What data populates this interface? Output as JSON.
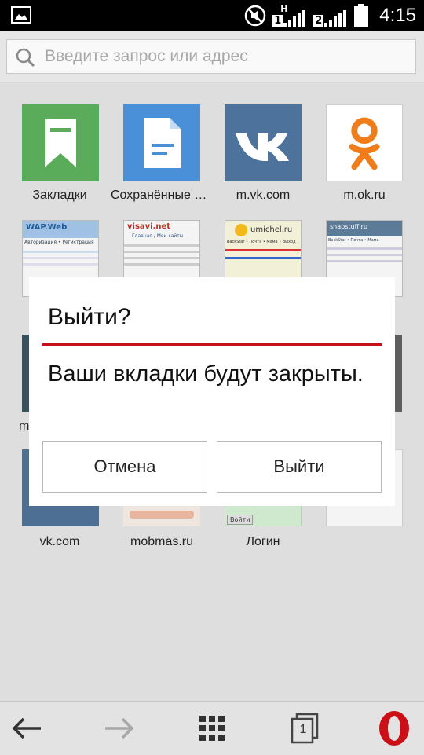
{
  "status_bar": {
    "time": "4:15",
    "icons": [
      "image-notification-icon",
      "mute-icon",
      "signal-sim1-icon",
      "signal-sim2-icon",
      "battery-icon"
    ],
    "sim1_label": "1",
    "sim2_label": "2",
    "network_label": "H"
  },
  "address_bar": {
    "placeholder": "Введите запрос или адрес",
    "value": ""
  },
  "speed_dial": {
    "row1": [
      {
        "label": "Закладки",
        "icon": "bookmark-icon",
        "color": "#5aab5a"
      },
      {
        "label": "Сохранённые страницы",
        "icon": "document-icon",
        "color": "#4a90d9"
      },
      {
        "label": "m.vk.com",
        "icon": "vk-logo-icon",
        "color": "#4d729c"
      },
      {
        "label": "m.ok.ru",
        "icon": "ok-logo-icon",
        "color": "#f07d1a"
      }
    ],
    "row2": [
      {
        "label": "",
        "thumb_text": "WAP.Web",
        "menu": "Авторизация • Регистрация"
      },
      {
        "label": "",
        "thumb_text": "visavi.net",
        "menu": "Главная / Мои сайты"
      },
      {
        "label": "",
        "thumb_text": "umichel.ru",
        "menu": "BackStar • Почта • Мама • Выход"
      },
      {
        "label": "",
        "thumb_text": "snapstuff.ru",
        "menu": "BackStar • Почта • Мама"
      }
    ],
    "row3_partial_label": "m",
    "row4": [
      {
        "label": "vk.com"
      },
      {
        "label": "mobmas.ru"
      },
      {
        "label": "Логин",
        "thumb_text": "Войти"
      },
      {
        "label": ""
      }
    ]
  },
  "dialog": {
    "title": "Выйти?",
    "message": "Ваши вкладки будут закрыты.",
    "cancel_label": "Отмена",
    "confirm_label": "Выйти",
    "accent_color": "#c4121b"
  },
  "bottom_nav": {
    "tabs_count": "1",
    "icons": [
      "back-arrow-icon",
      "forward-arrow-icon",
      "speed-dial-grid-icon",
      "tabs-icon",
      "opera-menu-icon"
    ],
    "opera_color": "#cc0f16"
  }
}
